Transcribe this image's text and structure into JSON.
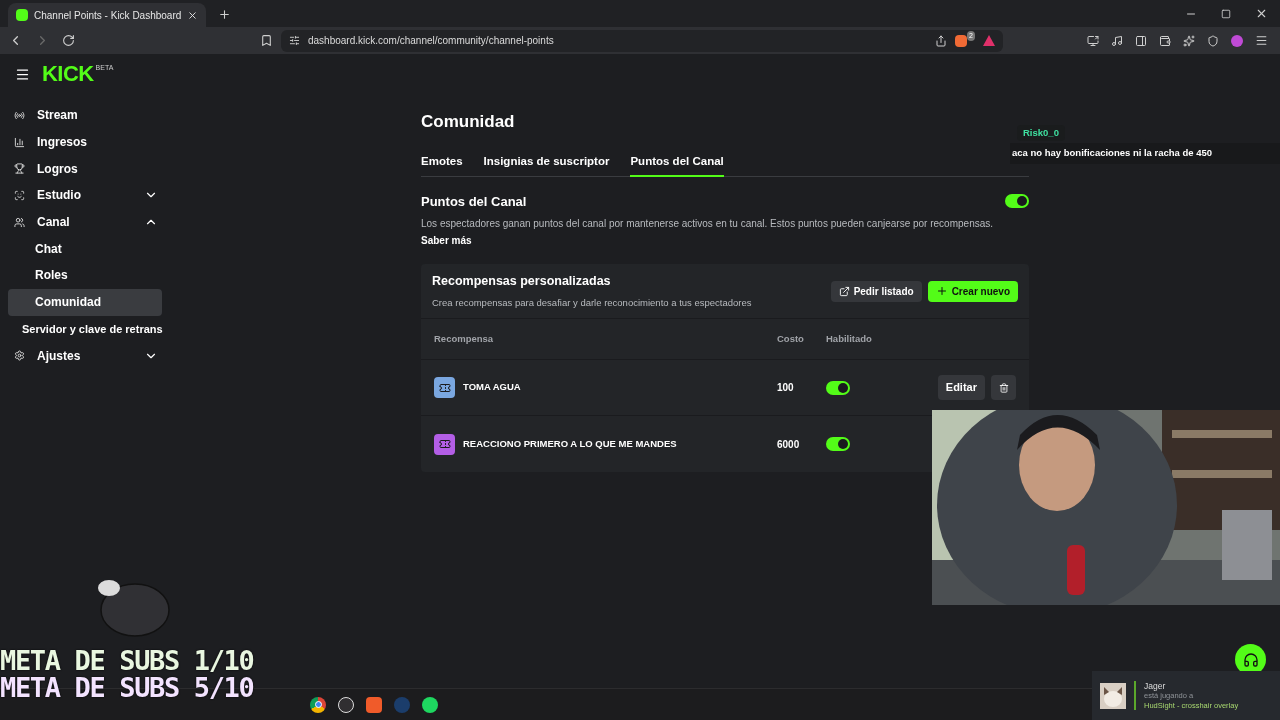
{
  "browser": {
    "tab_title": "Channel Points - Kick Dashboard",
    "url": "dashboard.kick.com/channel/community/channel-points",
    "shield_count": "2"
  },
  "logo": {
    "text": "KICK",
    "badge": "BETA"
  },
  "sidebar": {
    "items": [
      {
        "label": "Stream",
        "kind": "stream"
      },
      {
        "label": "Ingresos",
        "kind": "revenue"
      },
      {
        "label": "Logros",
        "kind": "trophy"
      },
      {
        "label": "Estudio",
        "kind": "studio",
        "expanded": false
      },
      {
        "label": "Canal",
        "kind": "channel",
        "expanded": true,
        "children": [
          {
            "label": "Chat",
            "selected": false
          },
          {
            "label": "Roles",
            "selected": false
          },
          {
            "label": "Comunidad",
            "selected": true
          }
        ]
      },
      {
        "label": "Servidor y clave de retrans",
        "kind": "plain"
      },
      {
        "label": "Ajustes",
        "kind": "settings",
        "expanded": false
      }
    ]
  },
  "page": {
    "title": "Comunidad",
    "tabs": [
      {
        "label": "Emotes",
        "selected": false
      },
      {
        "label": "Insignias de suscriptor",
        "selected": false
      },
      {
        "label": "Puntos del Canal",
        "selected": true
      }
    ],
    "section": {
      "title": "Puntos del Canal",
      "on": true,
      "description": "Los espectadores ganan puntos del canal por mantenerse activos en tu canal. Estos puntos pueden canjearse por recompensas.",
      "link": "Saber más"
    },
    "rewards": {
      "title": "Recompensas personalizadas",
      "subtitle": "Crea recompensas para desafiar y darle reconocimiento a tus espectadores",
      "buttons": [
        {
          "label": "Pedir listado",
          "kind": "secondary"
        },
        {
          "label": "Crear nuevo",
          "kind": "primary"
        }
      ],
      "columns": [
        "Recompensa",
        "Costo",
        "Habilitado"
      ],
      "rows": [
        {
          "name": "TOMA AGUA",
          "cost": "100",
          "enabled": true,
          "color": "#7aa7e0",
          "actions": [
            "Editar"
          ]
        },
        {
          "name": "REACCIONO PRIMERO A LO QUE ME MANDES",
          "cost": "6000",
          "enabled": true,
          "color": "#b35ee6"
        }
      ]
    }
  },
  "overlay": {
    "chat": {
      "user": "Risk0_0",
      "message": "aca no hay bonificaciones ni la racha de 450"
    },
    "goals": [
      {
        "text": "META DE SUBS 1/10",
        "color": "#e9f7e0"
      },
      {
        "text": "META DE SUBS 5/10",
        "color": "#f3e3ff"
      }
    ],
    "notification": {
      "name": "Jager",
      "status": "está jugando a",
      "game": "HudSight - crosshair overlay"
    }
  }
}
